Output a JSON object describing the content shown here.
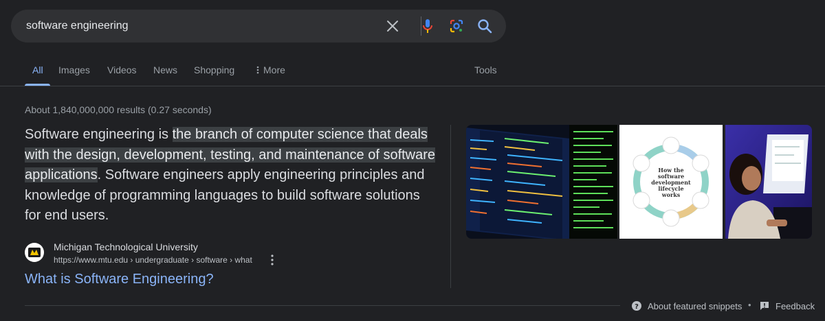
{
  "search": {
    "query": "software engineering",
    "icons": [
      "clear-icon",
      "mic-icon",
      "lens-icon",
      "search-icon"
    ]
  },
  "tabs": [
    {
      "label": "All",
      "active": true
    },
    {
      "label": "Images"
    },
    {
      "label": "Videos"
    },
    {
      "label": "News"
    },
    {
      "label": "Shopping"
    },
    {
      "label": "More"
    }
  ],
  "tools_label": "Tools",
  "results_stats": "About 1,840,000,000 results (0.27 seconds)",
  "snippet": {
    "prefix": "Software engineering is ",
    "highlight": "the branch of computer science that deals with the design, development, testing, and maintenance of software applications",
    "suffix": ". Software engineers apply engineering principles and knowledge of programming languages to build software solutions for end users."
  },
  "source": {
    "site_name": "Michigan Technological University",
    "url": "https://www.mtu.edu › undergraduate › software › what",
    "title": "What is Software Engineering?"
  },
  "images": {
    "infographic_text": "How the software development lifecycle works"
  },
  "footer": {
    "about_label": "About featured snippets",
    "feedback_label": "Feedback"
  },
  "colors": {
    "background": "#202124",
    "link": "#8ab4f8",
    "highlight": "#3c4043"
  }
}
